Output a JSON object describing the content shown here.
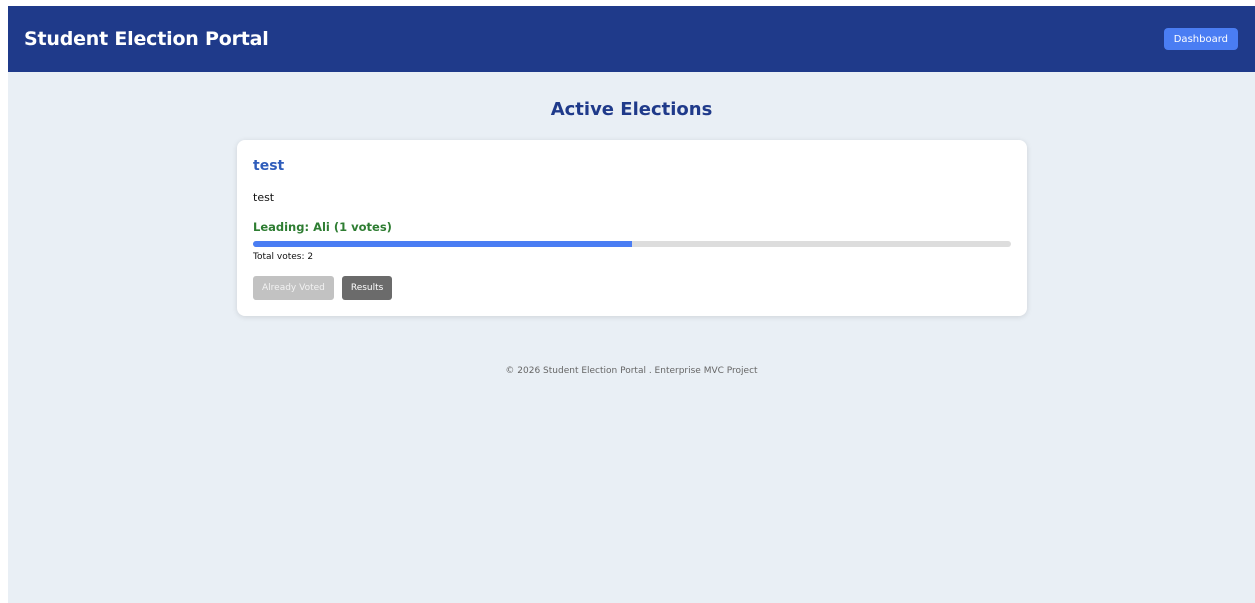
{
  "header": {
    "title": "Student Election Portal",
    "dashboard_label": "Dashboard"
  },
  "main": {
    "heading": "Active Elections",
    "elections": [
      {
        "title": "test",
        "description": "test",
        "leading": "Leading: Ali (1 votes)",
        "leading_share": 0.5,
        "total_votes": "Total votes: 2",
        "voted_label": "Already Voted",
        "results_label": "Results"
      }
    ]
  },
  "footer": {
    "text": "© 2026 Student Election Portal . Enterprise MVC Project"
  },
  "colors": {
    "header_bg": "#1f3a8a",
    "accent": "#4a7df3",
    "leading": "#2e7d32",
    "page_bg": "#e9eff5"
  }
}
